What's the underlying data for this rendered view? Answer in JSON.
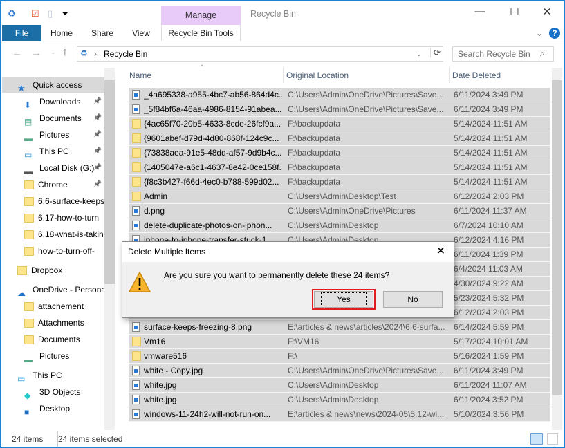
{
  "window": {
    "title": "Recycle Bin",
    "context_tab": "Manage",
    "minimize": "—",
    "maximize": "☐",
    "close": "✕"
  },
  "ribbon": {
    "tabs": [
      "File",
      "Home",
      "Share",
      "View",
      "Recycle Bin Tools"
    ],
    "collapse": "⌄",
    "help": "?"
  },
  "address": {
    "path": "Recycle Bin",
    "search_placeholder": "Search Recycle Bin"
  },
  "sidebar": {
    "items": [
      {
        "label": "Quick access",
        "icon": "star-icon",
        "indent": 1,
        "selected": true
      },
      {
        "label": "Downloads",
        "icon": "download-icon",
        "indent": 2,
        "pinned": true
      },
      {
        "label": "Documents",
        "icon": "documents-icon",
        "indent": 2,
        "pinned": true
      },
      {
        "label": "Pictures",
        "icon": "pictures-icon",
        "indent": 2,
        "pinned": true
      },
      {
        "label": "This PC",
        "icon": "computer-icon",
        "indent": 2,
        "pinned": true
      },
      {
        "label": "Local Disk (G:)",
        "icon": "drive-icon",
        "indent": 2,
        "pinned": true
      },
      {
        "label": "Chrome",
        "icon": "folder-icon",
        "indent": 2,
        "pinned": true
      },
      {
        "label": "6.6-surface-keeps",
        "icon": "folder-icon",
        "indent": 2
      },
      {
        "label": "6.17-how-to-turn",
        "icon": "folder-icon",
        "indent": 2
      },
      {
        "label": "6.18-what-is-takin",
        "icon": "folder-icon",
        "indent": 2
      },
      {
        "label": "how-to-turn-off-",
        "icon": "folder-icon",
        "indent": 2
      },
      {
        "label": "Dropbox",
        "icon": "folder-icon",
        "indent": 1,
        "gap": true
      },
      {
        "label": "OneDrive - Persona",
        "icon": "cloud-icon",
        "indent": 1,
        "gap": true
      },
      {
        "label": "attachement",
        "icon": "folder-icon",
        "indent": 2
      },
      {
        "label": "Attachments",
        "icon": "folder-icon",
        "indent": 2
      },
      {
        "label": "Documents",
        "icon": "folder-icon",
        "indent": 2
      },
      {
        "label": "Pictures",
        "icon": "pictures-icon",
        "indent": 2
      },
      {
        "label": "This PC",
        "icon": "computer-icon",
        "indent": 1,
        "gap": true
      },
      {
        "label": "3D Objects",
        "icon": "cube-icon",
        "indent": 2
      },
      {
        "label": "Desktop",
        "icon": "desktop-icon",
        "indent": 2
      }
    ]
  },
  "columns": [
    "Name",
    "Original Location",
    "Date Deleted"
  ],
  "files": [
    {
      "name": "_4a695338-a955-4bc7-ab56-864d4c...",
      "loc": "C:\\Users\\Admin\\OneDrive\\Pictures\\Save...",
      "date": "6/11/2024 3:49 PM",
      "type": "img"
    },
    {
      "name": "_5f84bf6a-46aa-4986-8154-91abea...",
      "loc": "C:\\Users\\Admin\\OneDrive\\Pictures\\Save...",
      "date": "6/11/2024 3:49 PM",
      "type": "img"
    },
    {
      "name": "{4ac65f70-20b5-4633-8cde-26fcf9a...",
      "loc": "F:\\backupdata",
      "date": "5/14/2024 11:51 AM",
      "type": "dir"
    },
    {
      "name": "{9601abef-d79d-4d80-868f-124c9c...",
      "loc": "F:\\backupdata",
      "date": "5/14/2024 11:51 AM",
      "type": "dir"
    },
    {
      "name": "{73838aea-91e5-48dd-af57-9d9b4c...",
      "loc": "F:\\backupdata",
      "date": "5/14/2024 11:51 AM",
      "type": "dir"
    },
    {
      "name": "{1405047e-a6c1-4637-8e42-0ce158f...",
      "loc": "F:\\backupdata",
      "date": "5/14/2024 11:51 AM",
      "type": "dir"
    },
    {
      "name": "{f8c3b427-f66d-4ec0-b788-599d02...",
      "loc": "F:\\backupdata",
      "date": "5/14/2024 11:51 AM",
      "type": "dir"
    },
    {
      "name": "Admin",
      "loc": "C:\\Users\\Admin\\Desktop\\Test",
      "date": "6/12/2024 2:03 PM",
      "type": "dir"
    },
    {
      "name": "d.png",
      "loc": "C:\\Users\\Admin\\OneDrive\\Pictures",
      "date": "6/11/2024 11:37 AM",
      "type": "img"
    },
    {
      "name": "delete-duplicate-photos-on-iphon...",
      "loc": "C:\\Users\\Admin\\Desktop",
      "date": "6/7/2024 10:10 AM",
      "type": "img"
    },
    {
      "name": "iphone-to-iphone-transfer-stuck-1...",
      "loc": "C:\\Users\\Admin\\Desktop",
      "date": "6/12/2024 4:16 PM",
      "type": "img"
    },
    {
      "name": "",
      "loc": "",
      "date": "6/11/2024 1:39 PM",
      "type": "img"
    },
    {
      "name": "",
      "loc": "",
      "date": "6/4/2024 11:03 AM",
      "type": "img"
    },
    {
      "name": "",
      "loc": "",
      "date": "4/30/2024 9:22 AM",
      "type": "img"
    },
    {
      "name": "",
      "loc": "",
      "date": "5/23/2024 5:32 PM",
      "type": "img"
    },
    {
      "name": "",
      "loc": "",
      "date": "6/12/2024 2:03 PM",
      "type": "img"
    },
    {
      "name": "surface-keeps-freezing-8.png",
      "loc": "E:\\articles & news\\articles\\2024\\6.6-surfa...",
      "date": "6/14/2024 5:59 PM",
      "type": "img"
    },
    {
      "name": "Vm16",
      "loc": "F:\\VM16",
      "date": "5/17/2024 10:01 AM",
      "type": "dir"
    },
    {
      "name": "vmware516",
      "loc": "F:\\",
      "date": "5/16/2024 1:59 PM",
      "type": "dir"
    },
    {
      "name": "white - Copy.jpg",
      "loc": "C:\\Users\\Admin\\OneDrive\\Pictures\\Save...",
      "date": "6/11/2024 3:49 PM",
      "type": "img"
    },
    {
      "name": "white.jpg",
      "loc": "C:\\Users\\Admin\\Desktop",
      "date": "6/11/2024 11:07 AM",
      "type": "img"
    },
    {
      "name": "white.jpg",
      "loc": "C:\\Users\\Admin\\Desktop",
      "date": "6/11/2024 3:52 PM",
      "type": "img"
    },
    {
      "name": "windows-11-24h2-will-not-run-on...",
      "loc": "E:\\articles & news\\news\\2024-05\\5.12-wi...",
      "date": "5/10/2024 3:56 PM",
      "type": "img"
    }
  ],
  "status": {
    "count": "24 items",
    "selected": "24 items selected"
  },
  "dialog": {
    "title": "Delete Multiple Items",
    "message": "Are you sure you want to permanently delete these 24 items?",
    "yes": "Yes",
    "no": "No",
    "close": "✕"
  },
  "colors": {
    "accent": "#1883d7",
    "file_tab": "#1b6ea6",
    "manage_tab": "#e8cbf8",
    "selection": "#d9d9d9",
    "highlight": "#e01c1c"
  }
}
